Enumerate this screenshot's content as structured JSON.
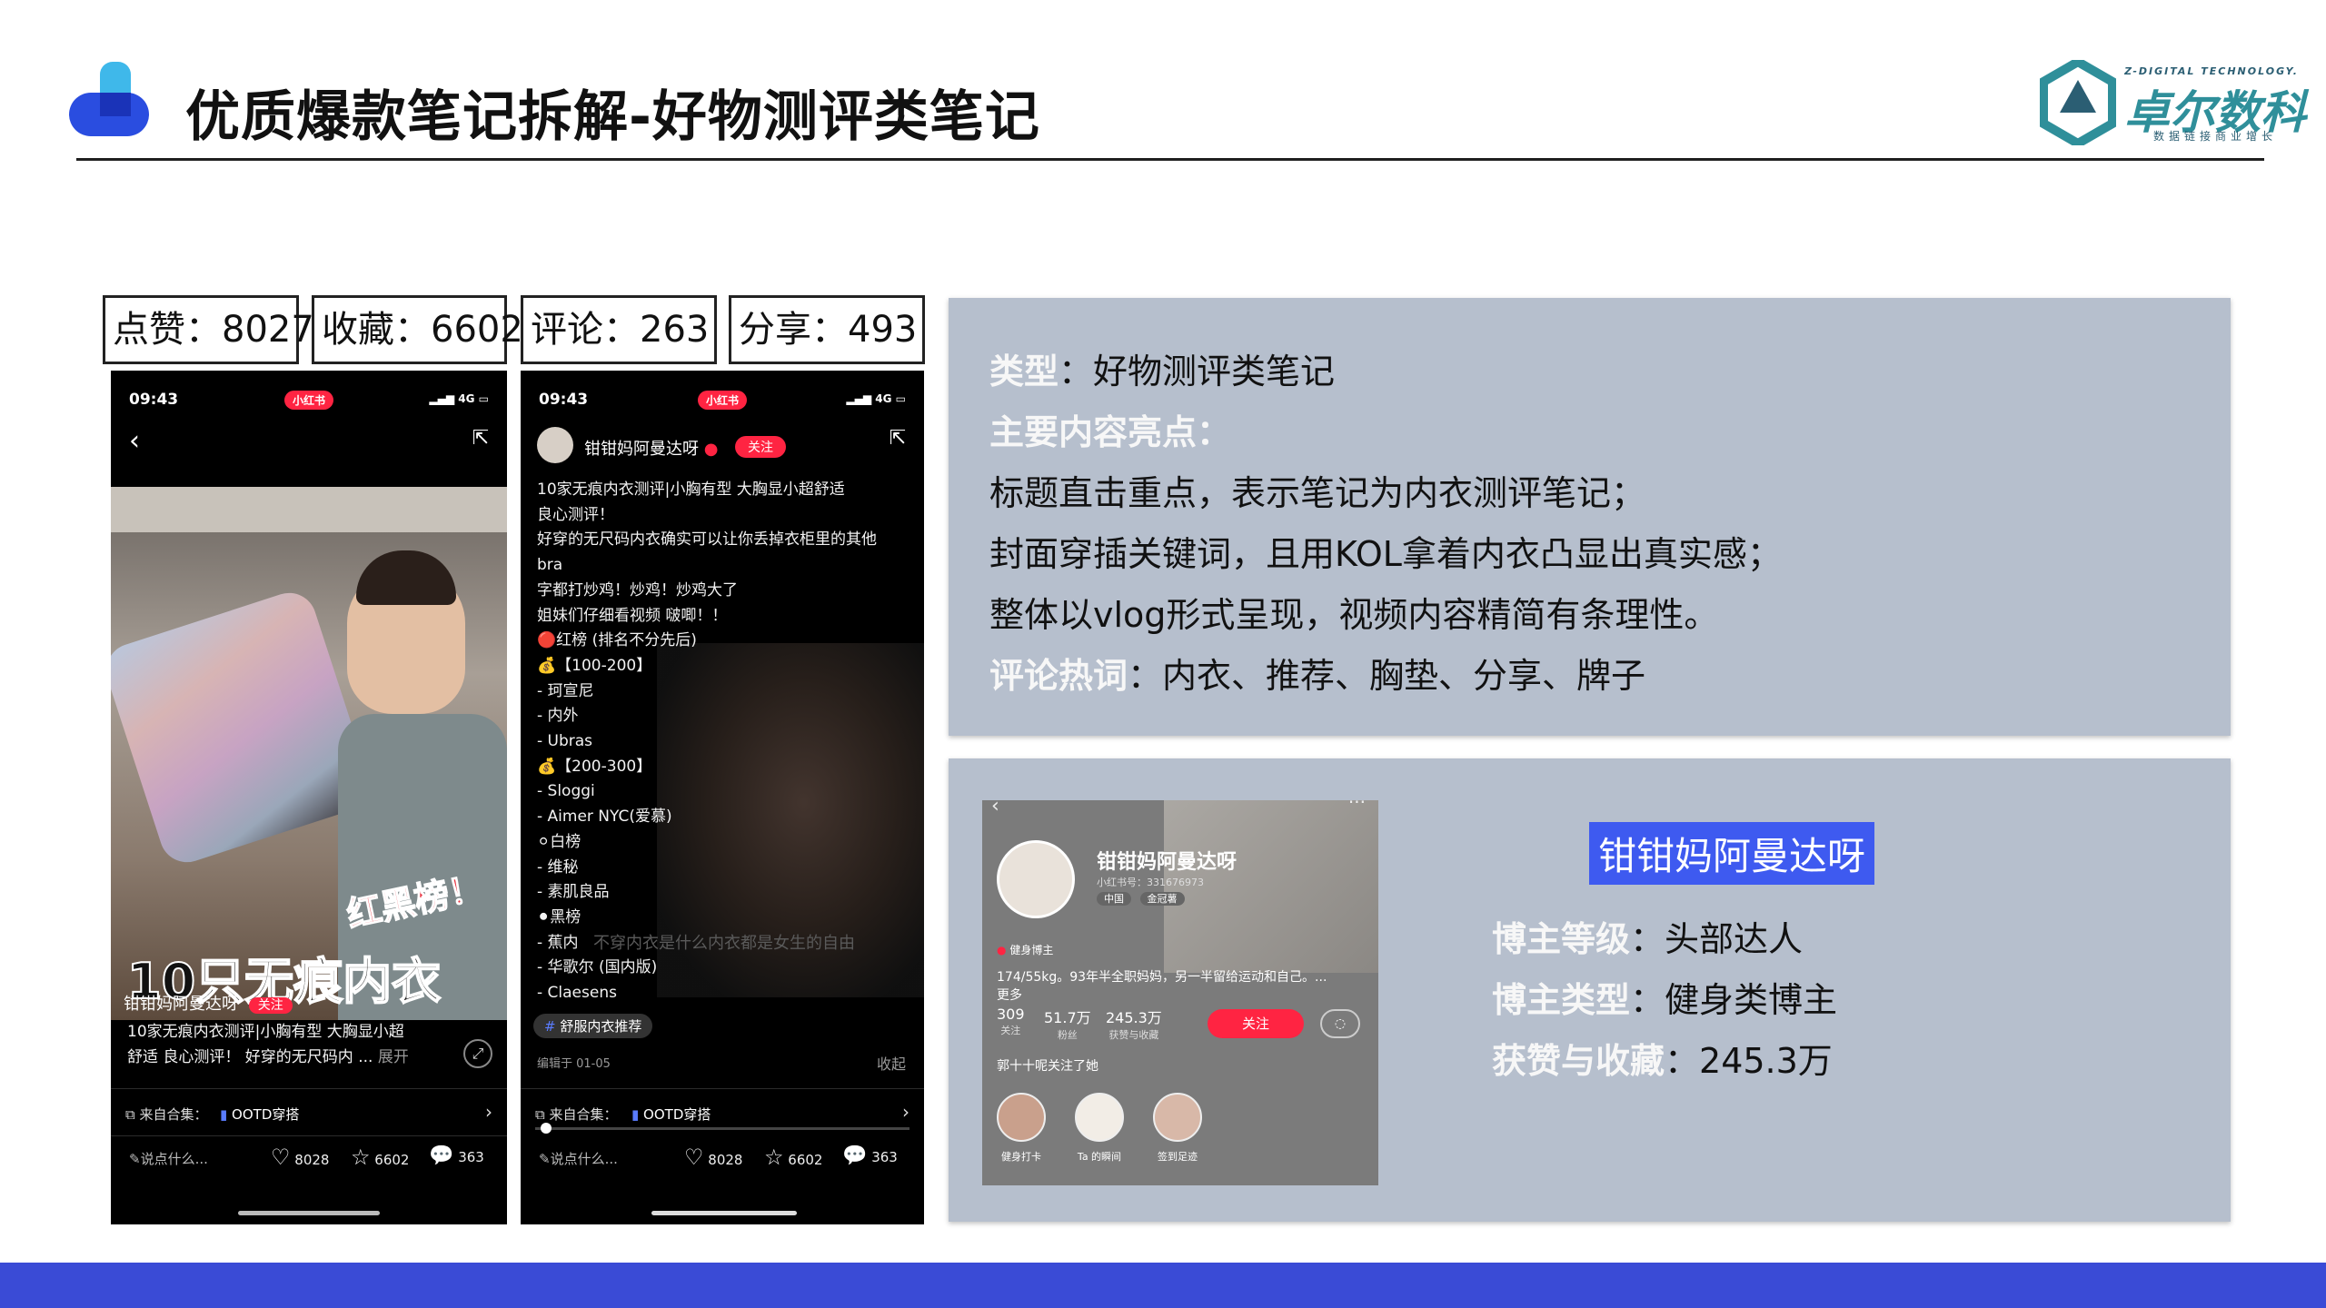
{
  "header": {
    "title": "优质爆款笔记拆解-好物测评类笔记",
    "brand_en": "Z-DIGITAL TECHNOLOGY.",
    "brand_cn": "卓尔数科",
    "brand_sub": "数据链接商业增长"
  },
  "stats": {
    "likes": "点赞：8027",
    "favorites": "收藏：6602",
    "comments": "评论：263",
    "shares": "分享：493"
  },
  "phone1": {
    "time": "09:43",
    "app_badge": "小红书",
    "network": "4G",
    "cover_text_1": "红黑榜！",
    "cover_text_2": "10只无痕内衣",
    "cover_author": "钳钳妈阿曼达呀",
    "cover_follow": "关注",
    "caption_1": "10家无痕内衣测评|小胸有型 大胸显小超",
    "caption_2": "舒适 良心测评！ 好穿的无尺码内 ...",
    "expand": "展开",
    "collection_label": "来自合集：",
    "collection_name": "OOTD穿搭",
    "comment_placeholder": "说点什么...",
    "like_count": "8028",
    "fav_count": "6602",
    "comment_count": "363"
  },
  "phone2": {
    "time": "09:43",
    "app_badge": "小红书",
    "network": "4G",
    "author": "钳钳妈阿曼达呀",
    "follow": "关注",
    "lines": [
      "10家无痕内衣测评|小胸有型 大胸显小超舒适",
      "良心测评！",
      "好穿的无尺码内衣确实可以让你丢掉衣柜里的其他",
      "bra",
      "字都打炒鸡！炒鸡！炒鸡大了",
      "姐妹们仔细看视频 啵唧！！",
      "🔴红榜 (排名不分先后)",
      "💰【100-200】",
      "- 珂宣尼",
      "- 内外",
      "- Ubras",
      "💰【200-300】",
      "- Sloggi",
      "- Aimer NYC(爱慕)",
      "⚪白榜",
      "- 维秘",
      "- 素肌良品",
      "⚫黑榜",
      "- 蕉内",
      "- 华歌尔 (国内版)",
      "- Claesens"
    ],
    "overlay_sub": "不穿内衣是什么内衣都是女生的自由",
    "tag": "舒服内衣推荐",
    "edited": "编辑于 01-05",
    "collapse": "收起",
    "collection_label": "来自合集：",
    "collection_name": "OOTD穿搭",
    "comment_placeholder": "说点什么...",
    "like_count": "8028",
    "fav_count": "6602",
    "comment_count": "363"
  },
  "analysis": {
    "type_label": "类型",
    "type_value": "：好物测评类笔记",
    "highlights_label": "主要内容亮点：",
    "points": [
      "标题直击重点，表示笔记为内衣测评笔记；",
      "封面穿插关键词，且用KOL拿着内衣凸显出真实感；",
      "整体以vlog形式呈现，视频内容精简有条理性。"
    ],
    "hot_label": "评论热词",
    "hot_value": "：内衣、推荐、胸垫、分享、牌子"
  },
  "profile_shot": {
    "name": "钳钳妈阿曼达呀",
    "id": "小红书号：331676973",
    "tag1": "中国",
    "tag2": "金冠薯",
    "badge": "健身博主",
    "bio": "174/55kg。93年半全职妈妈，另一半留给运动和自己。...",
    "more": "更多",
    "following": "309",
    "following_label": "关注",
    "fans": "51.7万",
    "fans_label": "粉丝",
    "liked": "245.3万",
    "liked_label": "获赞与收藏",
    "follow": "关注",
    "followed_by": "郭十十呢关注了她",
    "highlight1": "健身打卡",
    "highlight2": "Ta 的瞬间",
    "highlight3": "签到足迹"
  },
  "blogger": {
    "name": "钳钳妈阿曼达呀",
    "level_label": "博主等级",
    "level_value": "：头部达人",
    "type_label": "博主类型",
    "type_value": "：健身类博主",
    "liked_label": "获赞与收藏",
    "liked_value": "：245.3万"
  },
  "colors": {
    "panel": "#b6bfcd",
    "accent_blue": "#3e5af0",
    "xhs_red": "#ff2442",
    "footer": "#3a4bd6"
  }
}
